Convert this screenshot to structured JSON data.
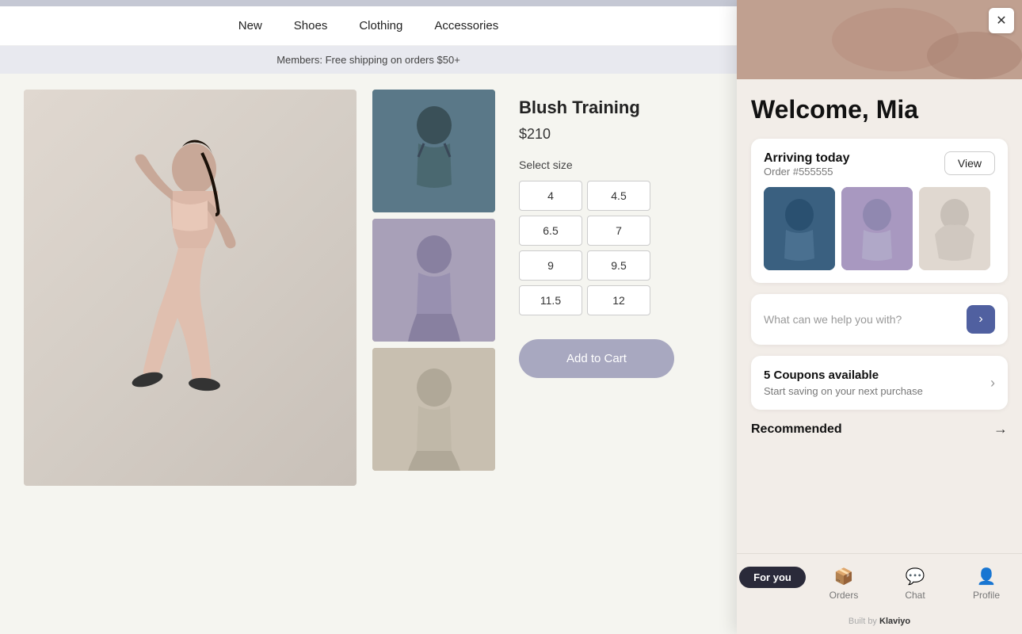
{
  "nav": {
    "items": [
      "New",
      "Shoes",
      "Clothing",
      "Accessories"
    ]
  },
  "promo": {
    "text": "Members: Free shipping on orders $50+"
  },
  "product": {
    "title": "Blush Training",
    "price": "$210",
    "size_label": "Select size",
    "sizes": [
      "4",
      "4.5",
      "6.5",
      "7",
      "9",
      "9.5",
      "11.5",
      "12"
    ],
    "add_button": "Add to Cart"
  },
  "panel": {
    "close_label": "×",
    "welcome": "Welcome, Mia",
    "order": {
      "arriving_label": "Arriving today",
      "order_number": "Order #555555",
      "view_button": "View"
    },
    "chat": {
      "placeholder": "What can we help you with?"
    },
    "coupons": {
      "count": "5 Coupons available",
      "sub": "Start saving on your next purchase"
    },
    "recommended": {
      "title": "Recommended"
    },
    "bottom_nav": {
      "tabs": [
        {
          "label": "For you",
          "active": true
        },
        {
          "label": "Orders",
          "active": false
        },
        {
          "label": "Chat",
          "active": false
        },
        {
          "label": "Profile",
          "active": false
        }
      ]
    },
    "footer": "Built by"
  }
}
